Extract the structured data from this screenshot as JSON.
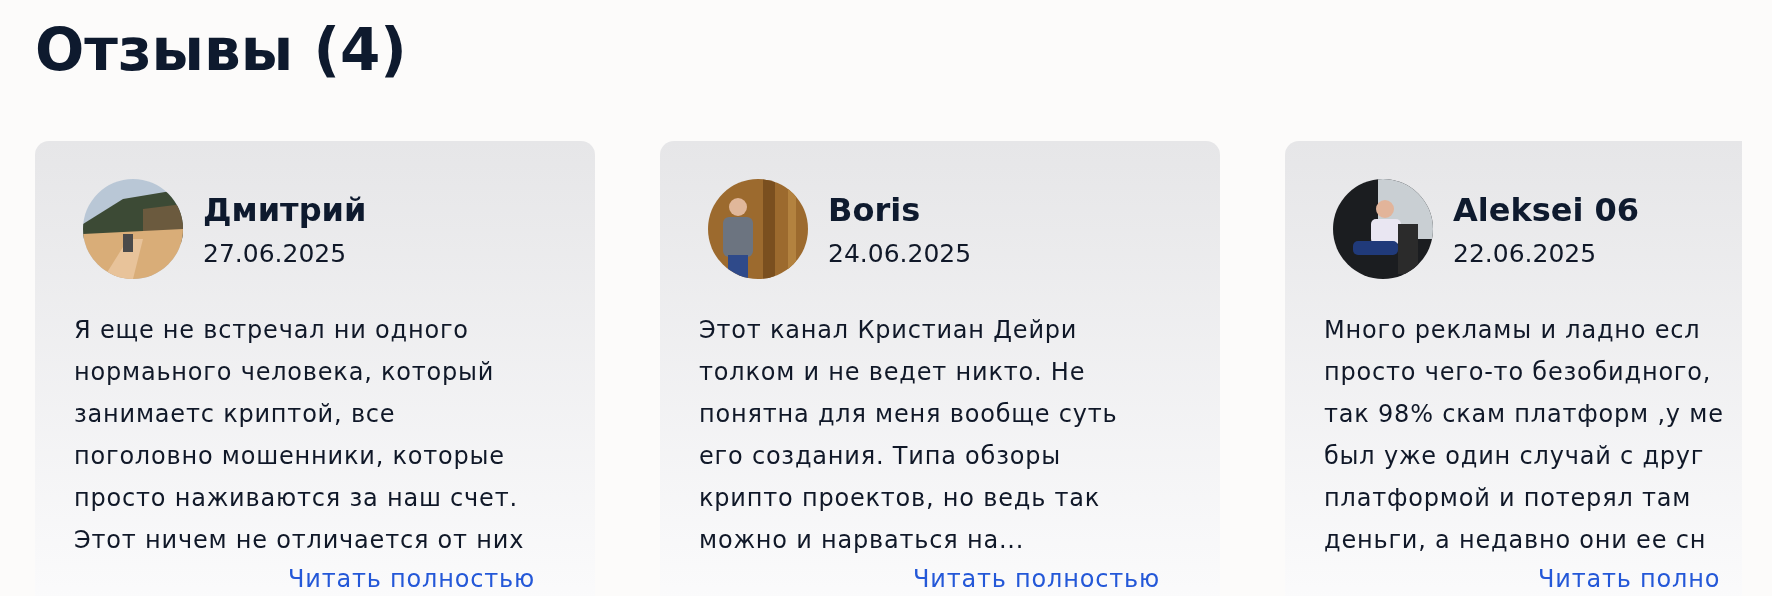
{
  "heading": "Отзывы (4)",
  "reviews": [
    {
      "name": "Дмитрий",
      "date": "27.06.2025",
      "text": "Я еще не встречал ни одного\nнормаьного человека, который\nзанимаетс криптой, все\nпоголовно мошенники, которые\nпросто наживаются за наш счет.\nЭтот ничем не отличается от них",
      "link": "Читать полностью"
    },
    {
      "name": "Boris",
      "date": "24.06.2025",
      "text": "Этот канал Кристиан Дейри\nтолком и не ведет никто. Не\nпонятна для меня вообще суть\nего создания. Типа обзоры\nкрипто проектов, но ведь так\nможно и нарваться на...",
      "link": "Читать полностью"
    },
    {
      "name": "Aleksei 06",
      "date": "22.06.2025",
      "text": "Много рекламы и ладно есл\nпросто чего-то безобидного,\nтак 98% скам платформ ,у ме\nбыл уже один случай с друг\nплатформой и потерял там\nденьги, а недавно они ее сн",
      "link": "Читать полно"
    }
  ]
}
